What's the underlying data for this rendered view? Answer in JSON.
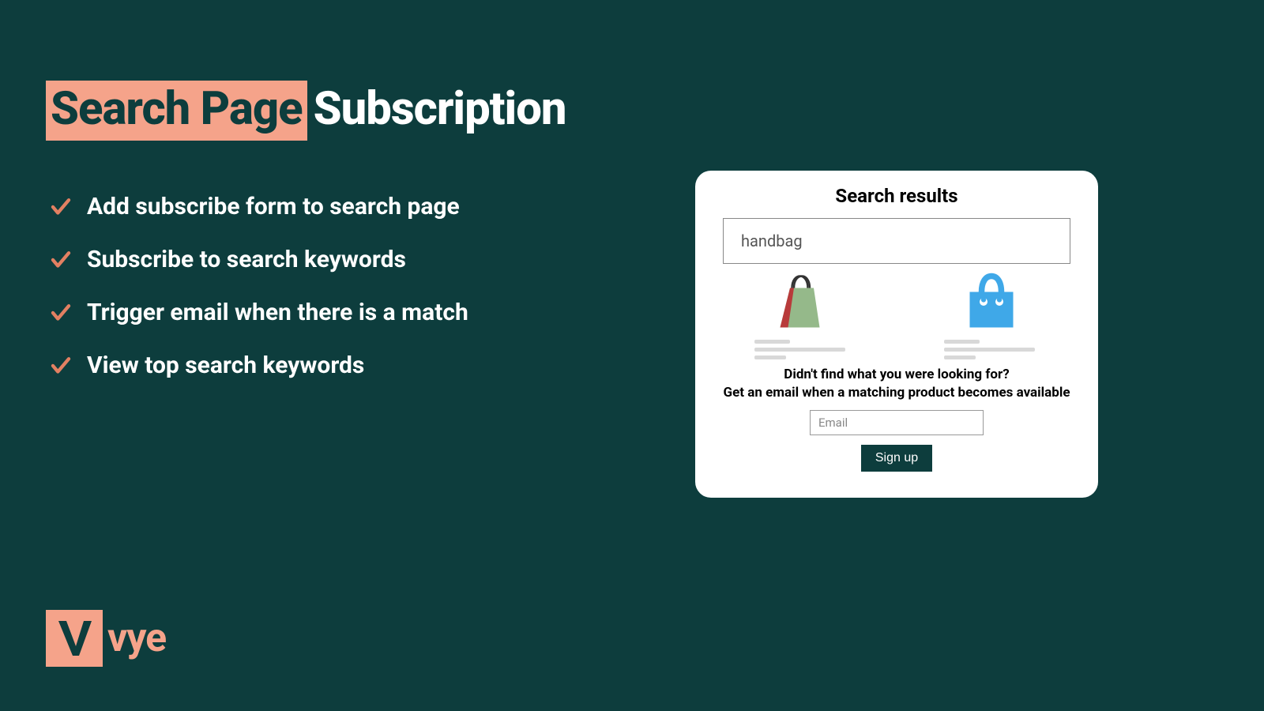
{
  "colors": {
    "background": "#0d3d3d",
    "accent": "#f5a38a",
    "text_light": "#ffffff"
  },
  "heading": {
    "highlight": "Search Page",
    "rest": "Subscription"
  },
  "features": [
    "Add subscribe form to search page",
    "Subscribe to search keywords",
    "Trigger email when there is a match",
    "View top search keywords"
  ],
  "card": {
    "title": "Search results",
    "search_value": "handbag",
    "prompt_line1": "Didn't find what you were looking for?",
    "prompt_line2": "Get an email when a matching product becomes available",
    "email_placeholder": "Email",
    "signup_label": "Sign up"
  },
  "logo": {
    "text": "vye"
  }
}
